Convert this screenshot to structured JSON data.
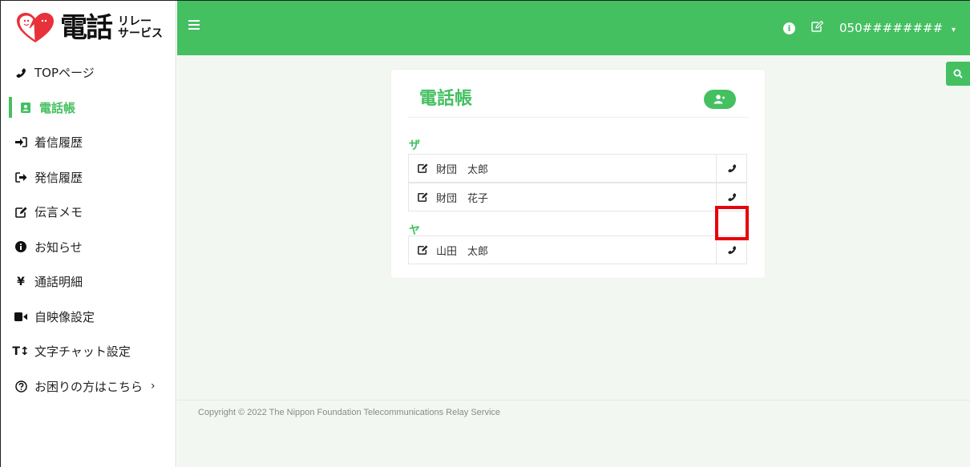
{
  "logo": {
    "main": "電話",
    "sub_top": "リレー",
    "sub_bottom": "サービス"
  },
  "sidebar": {
    "items": [
      {
        "label": "TOPページ",
        "icon": "phone-icon"
      },
      {
        "label": "電話帳",
        "icon": "address-book-icon",
        "active": true
      },
      {
        "label": "着信履歴",
        "icon": "sign-in-icon"
      },
      {
        "label": "発信履歴",
        "icon": "sign-out-icon"
      },
      {
        "label": "伝言メモ",
        "icon": "edit-icon"
      },
      {
        "label": "お知らせ",
        "icon": "info-icon"
      },
      {
        "label": "通話明細",
        "icon": "yen-icon"
      },
      {
        "label": "自映像設定",
        "icon": "video-icon"
      },
      {
        "label": "文字チャット設定",
        "icon": "text-height-icon"
      },
      {
        "label": "お困りの方はこちら",
        "icon": "question-circle-icon"
      }
    ]
  },
  "topbar": {
    "phone_number": "050########"
  },
  "phonebook": {
    "title": "電話帳",
    "groups": [
      {
        "label": "ザ",
        "contacts": [
          {
            "name": "財団　太郎"
          },
          {
            "name": "財団　花子"
          }
        ]
      },
      {
        "label": "ヤ",
        "contacts": [
          {
            "name": "山田　太郎"
          }
        ]
      }
    ]
  },
  "footer": {
    "copyright": "Copyright © 2022 The Nippon Foundation Telecommunications Relay Service"
  },
  "colors": {
    "accent": "#44c061",
    "highlight": "#e8000b",
    "background": "#f3f7f1"
  }
}
